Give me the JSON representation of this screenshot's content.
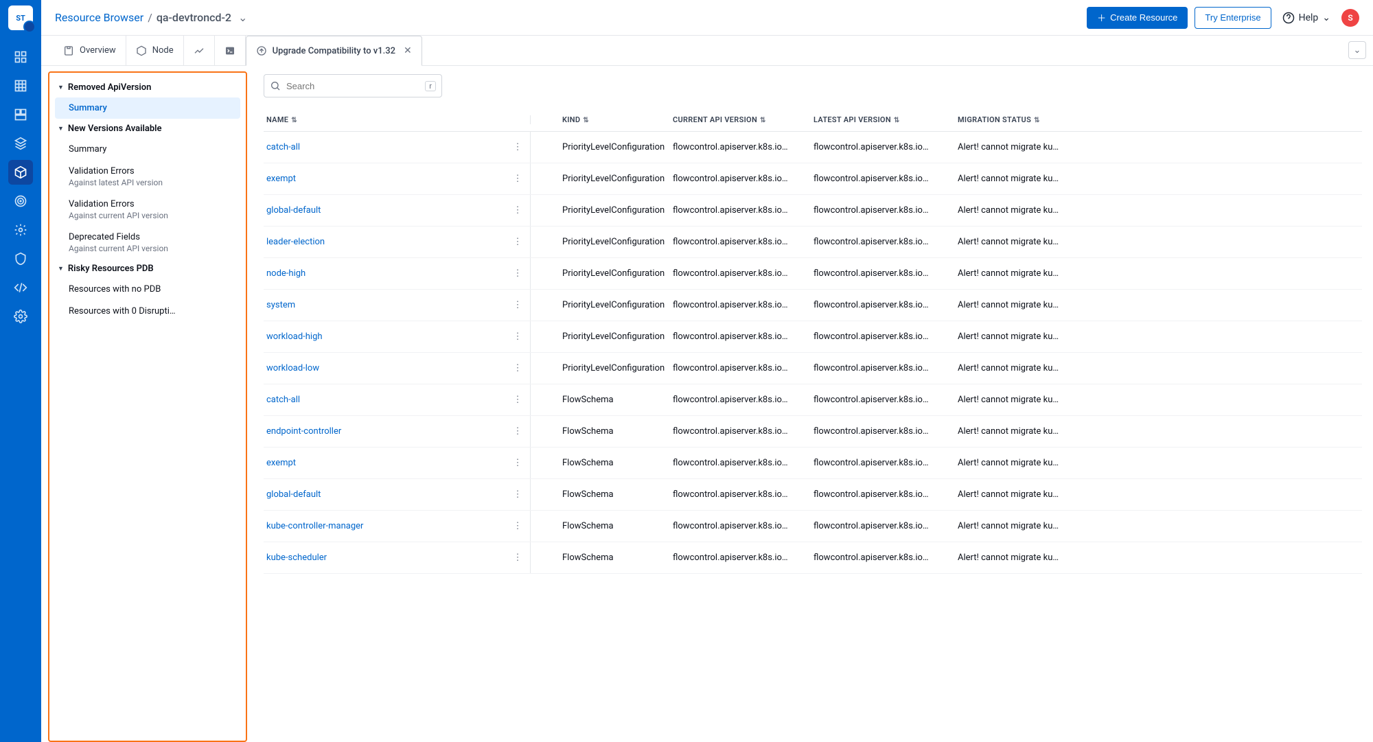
{
  "header": {
    "breadcrumb_root": "Resource Browser",
    "breadcrumb_sep": "/",
    "breadcrumb_leaf": "qa-devtroncd-2",
    "create_btn": "Create Resource",
    "try_btn": "Try Enterprise",
    "help_label": "Help",
    "avatar_initial": "S",
    "logo_text": "ST"
  },
  "tabs": {
    "overview": "Overview",
    "node": "Node",
    "upgrade": "Upgrade Compatibility to v1.32"
  },
  "sidebar": {
    "g1": "Removed ApiVersion",
    "g1_summary": "Summary",
    "g2": "New Versions Available",
    "g2_summary": "Summary",
    "g2_val_latest": "Validation Errors",
    "g2_val_latest_sub": "Against latest API version",
    "g2_val_current": "Validation Errors",
    "g2_val_current_sub": "Against current API version",
    "g2_dep": "Deprecated Fields",
    "g2_dep_sub": "Against current API version",
    "g3": "Risky Resources PDB",
    "g3_nopdb": "Resources with no PDB",
    "g3_zero": "Resources with 0 Disrupti…"
  },
  "search": {
    "placeholder": "Search",
    "kbd": "r"
  },
  "columns": {
    "name": "NAME",
    "kind": "KIND",
    "current": "CURRENT API VERSION",
    "latest": "LATEST API VERSION",
    "migration": "MIGRATION STATUS"
  },
  "rows": [
    {
      "name": "catch-all",
      "kind": "PriorityLevelConfiguration",
      "cur": "flowcontrol.apiserver.k8s.io…",
      "lat": "flowcontrol.apiserver.k8s.io…",
      "mig": "Alert! cannot migrate ku…"
    },
    {
      "name": "exempt",
      "kind": "PriorityLevelConfiguration",
      "cur": "flowcontrol.apiserver.k8s.io…",
      "lat": "flowcontrol.apiserver.k8s.io…",
      "mig": "Alert! cannot migrate ku…"
    },
    {
      "name": "global-default",
      "kind": "PriorityLevelConfiguration",
      "cur": "flowcontrol.apiserver.k8s.io…",
      "lat": "flowcontrol.apiserver.k8s.io…",
      "mig": "Alert! cannot migrate ku…"
    },
    {
      "name": "leader-election",
      "kind": "PriorityLevelConfiguration",
      "cur": "flowcontrol.apiserver.k8s.io…",
      "lat": "flowcontrol.apiserver.k8s.io…",
      "mig": "Alert! cannot migrate ku…"
    },
    {
      "name": "node-high",
      "kind": "PriorityLevelConfiguration",
      "cur": "flowcontrol.apiserver.k8s.io…",
      "lat": "flowcontrol.apiserver.k8s.io…",
      "mig": "Alert! cannot migrate ku…"
    },
    {
      "name": "system",
      "kind": "PriorityLevelConfiguration",
      "cur": "flowcontrol.apiserver.k8s.io…",
      "lat": "flowcontrol.apiserver.k8s.io…",
      "mig": "Alert! cannot migrate ku…"
    },
    {
      "name": "workload-high",
      "kind": "PriorityLevelConfiguration",
      "cur": "flowcontrol.apiserver.k8s.io…",
      "lat": "flowcontrol.apiserver.k8s.io…",
      "mig": "Alert! cannot migrate ku…"
    },
    {
      "name": "workload-low",
      "kind": "PriorityLevelConfiguration",
      "cur": "flowcontrol.apiserver.k8s.io…",
      "lat": "flowcontrol.apiserver.k8s.io…",
      "mig": "Alert! cannot migrate ku…"
    },
    {
      "name": "catch-all",
      "kind": "FlowSchema",
      "cur": "flowcontrol.apiserver.k8s.io…",
      "lat": "flowcontrol.apiserver.k8s.io…",
      "mig": "Alert! cannot migrate ku…"
    },
    {
      "name": "endpoint-controller",
      "kind": "FlowSchema",
      "cur": "flowcontrol.apiserver.k8s.io…",
      "lat": "flowcontrol.apiserver.k8s.io…",
      "mig": "Alert! cannot migrate ku…"
    },
    {
      "name": "exempt",
      "kind": "FlowSchema",
      "cur": "flowcontrol.apiserver.k8s.io…",
      "lat": "flowcontrol.apiserver.k8s.io…",
      "mig": "Alert! cannot migrate ku…"
    },
    {
      "name": "global-default",
      "kind": "FlowSchema",
      "cur": "flowcontrol.apiserver.k8s.io…",
      "lat": "flowcontrol.apiserver.k8s.io…",
      "mig": "Alert! cannot migrate ku…"
    },
    {
      "name": "kube-controller-manager",
      "kind": "FlowSchema",
      "cur": "flowcontrol.apiserver.k8s.io…",
      "lat": "flowcontrol.apiserver.k8s.io…",
      "mig": "Alert! cannot migrate ku…"
    },
    {
      "name": "kube-scheduler",
      "kind": "FlowSchema",
      "cur": "flowcontrol.apiserver.k8s.io…",
      "lat": "flowcontrol.apiserver.k8s.io…",
      "mig": "Alert! cannot migrate ku…"
    }
  ]
}
